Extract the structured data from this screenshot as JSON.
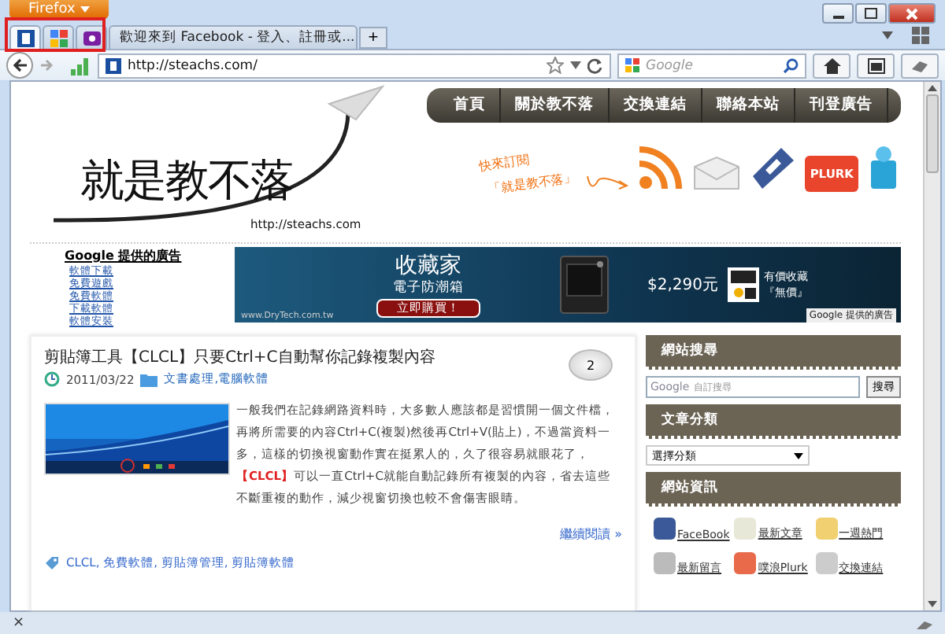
{
  "browser": {
    "menu_button": "Firefox",
    "tabs": [
      {
        "kind": "pinned",
        "selected": true
      },
      {
        "kind": "pinned",
        "selected": false
      },
      {
        "kind": "pinned",
        "selected": false
      },
      {
        "kind": "normal",
        "title": "歡迎來到 Facebook - 登入、註冊或...",
        "selected": false
      }
    ],
    "new_tab": "+",
    "url": "http://steachs.com/",
    "search_placeholder": "Google",
    "status_close": "×"
  },
  "site": {
    "logo": "就是教不落",
    "logo_url": "http://steachs.com",
    "nav": [
      "首頁",
      "關於教不落",
      "交換連結",
      "聯絡本站",
      "刊登廣告"
    ],
    "subscribe": [
      "快來訂閱",
      "「就是教不落」"
    ],
    "plurk": "PLURK"
  },
  "ads": {
    "heading": "Google 提供的廣告",
    "links": [
      "軟體下載",
      "免費遊戲",
      "免費軟體",
      "下載軟體",
      "軟體安裝"
    ],
    "banner": {
      "title": "收藏家",
      "subtitle": "電子防潮箱",
      "button": "立即購買！",
      "site": "www.DryTech.com.tw",
      "price": "$2,290元",
      "slogan": [
        "有價收藏",
        "『無價』"
      ],
      "footer": "Google 提供的廣告"
    }
  },
  "post": {
    "title": "剪貼簿工具【CLCL】只要Ctrl+C自動幫你記錄複製內容",
    "date": "2011/03/22",
    "category": "文書處理,電腦軟體",
    "comments": "2",
    "body": "一般我們在記錄網路資料時，大多數人應該都是習慣開一個文件檔，再將所需要的內容Ctrl+C(複製)然後再Ctrl+V(貼上)，不過當資料一多，這樣的切換視窗動作實在挺累人的，久了很容易就眼花了，**【CLCL】**可以一直Ctrl+C就能自動記錄所有複製的內容，省去這些不斷重複的動作，減少視窗切換也較不會傷害眼睛。",
    "more": "繼續閱讀 »",
    "tags": "CLCL, 免費軟體, 剪貼簿管理, 剪貼簿軟體"
  },
  "sidebar": [
    {
      "kind": "search",
      "title": "網站搜尋",
      "brand": "Google",
      "placeholder": "自訂搜尋",
      "button": "搜尋"
    },
    {
      "kind": "select",
      "title": "文章分類",
      "value": "選擇分類"
    },
    {
      "kind": "links",
      "title": "網站資訊",
      "links": [
        "FaceBook",
        "最新文章",
        "一週熱門",
        "最新留言",
        "噗浪Plurk",
        "交換連結"
      ]
    }
  ]
}
